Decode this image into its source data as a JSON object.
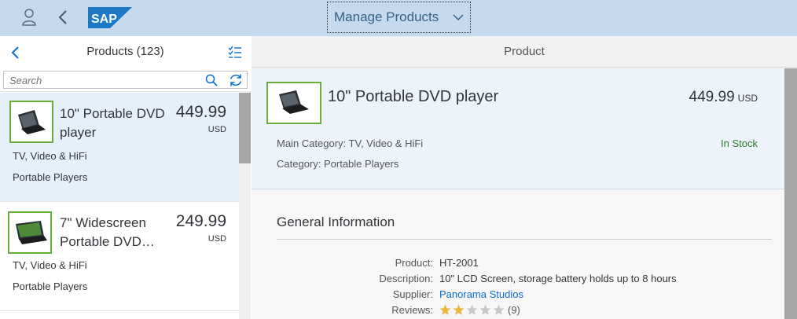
{
  "shell": {
    "title": "Manage Products",
    "logo_text": "SAP",
    "icons": {
      "user": "person-icon",
      "back": "back-arrow-icon",
      "dropdown": "chevron-down-icon"
    }
  },
  "master": {
    "title": "Products (123)",
    "search_placeholder": "Search",
    "icons": {
      "back": "back-arrow-icon",
      "multiselect": "multi-select-icon",
      "search": "search-icon",
      "refresh": "refresh-icon"
    },
    "items": [
      {
        "name": "10\" Portable DVD player",
        "price": "449.99",
        "currency": "USD",
        "main_category": "TV, Video & HiFi",
        "category": "Portable Players",
        "selected": true
      },
      {
        "name": "7\" Widescreen Portable DVD…",
        "price": "249.99",
        "currency": "USD",
        "main_category": "TV, Video & HiFi",
        "category": "Portable Players",
        "selected": false
      }
    ]
  },
  "detail": {
    "title": "Product",
    "product_name": "10\" Portable DVD player",
    "price": "449.99",
    "currency": "USD",
    "main_category": "Main Category: TV, Video & HiFi",
    "category": "Category: Portable Players",
    "status": "In Stock",
    "status_color": "#2b7c2b",
    "section": {
      "title": "General Information",
      "fields": [
        {
          "label": "Product:",
          "value": "HT-2001"
        },
        {
          "label": "Description:",
          "value": "10\" LCD Screen, storage battery holds up to 8 hours"
        },
        {
          "label": "Supplier:",
          "value": "Panorama Studios"
        },
        {
          "label": "Reviews:",
          "value": "(9)"
        }
      ],
      "rating": 2,
      "rating_max": 5
    }
  },
  "colors": {
    "shell_bg": "#c7d9ec",
    "accent": "#0a6ed1",
    "selection": "#e5f0fa",
    "thumb_border": "#6aae3a"
  }
}
